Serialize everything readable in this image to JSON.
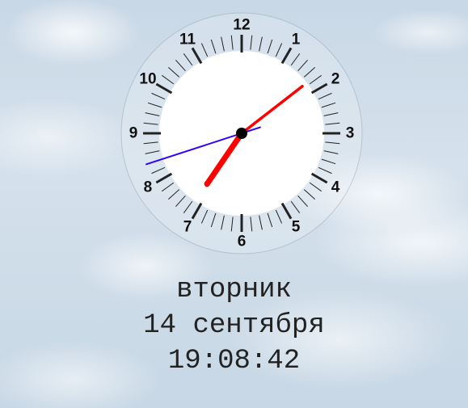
{
  "clock": {
    "numerals": [
      "12",
      "1",
      "2",
      "3",
      "4",
      "5",
      "6",
      "7",
      "8",
      "9",
      "10",
      "11"
    ],
    "hours": 19,
    "minutes": 8,
    "seconds": 42,
    "colors": {
      "face": "#ffffff",
      "ticks": "#222222",
      "numerals": "#111111",
      "hour_hand": "#ff0000",
      "minute_hand": "#ff0000",
      "second_hand": "#3300ff",
      "center": "#000000"
    }
  },
  "display": {
    "weekday": "вторник",
    "date": "14 сентября",
    "time": "19:08:42"
  }
}
